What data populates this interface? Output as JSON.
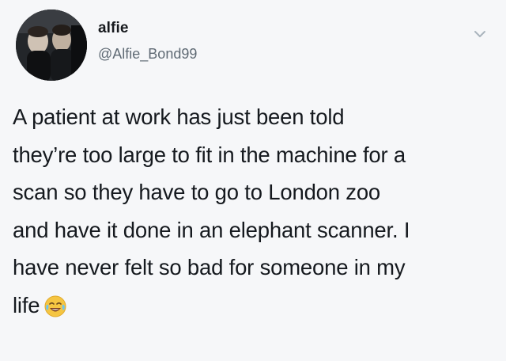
{
  "tweet": {
    "display_name": "alfie",
    "handle": "@Alfie_Bond99",
    "text_lines": [
      "A patient at work has just been told",
      "they’re too large to fit in the machine for a",
      "scan so they have to go to London zoo",
      "and have it done in an elephant scanner. I",
      "have never felt so bad for someone in my",
      "life"
    ],
    "emoji": "crying-laughing-face",
    "menu_icon": "chevron-down-icon"
  },
  "colors": {
    "background": "#f6f7f9",
    "text": "#15191e",
    "handle": "#5f6a74",
    "caret": "#aab4bd",
    "emoji_face": "#f5c542"
  }
}
